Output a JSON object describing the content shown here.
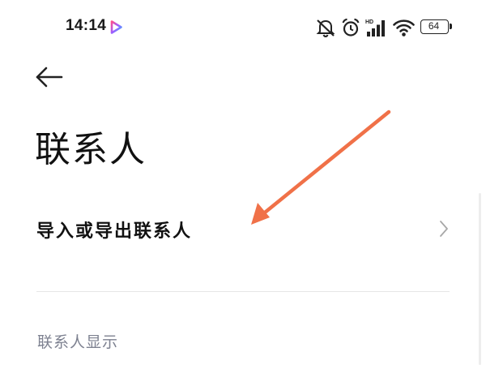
{
  "status_bar": {
    "time": "14:14",
    "battery_level": "64",
    "network_badge": "HD",
    "icons": [
      "app-play-icon",
      "mute-icon",
      "alarm-icon",
      "signal-icon",
      "wifi-icon",
      "battery-icon"
    ]
  },
  "header": {
    "back_icon": "arrow-left-icon",
    "title": "联系人"
  },
  "items": [
    {
      "label": "导入或导出联系人",
      "icon": "chevron-right-icon"
    }
  ],
  "sections": [
    {
      "header": "联系人显示"
    }
  ],
  "colors": {
    "annotation_arrow": "#f07148",
    "section_header": "#7d8190",
    "divider": "#e6e6e6",
    "title_text": "#111111"
  }
}
